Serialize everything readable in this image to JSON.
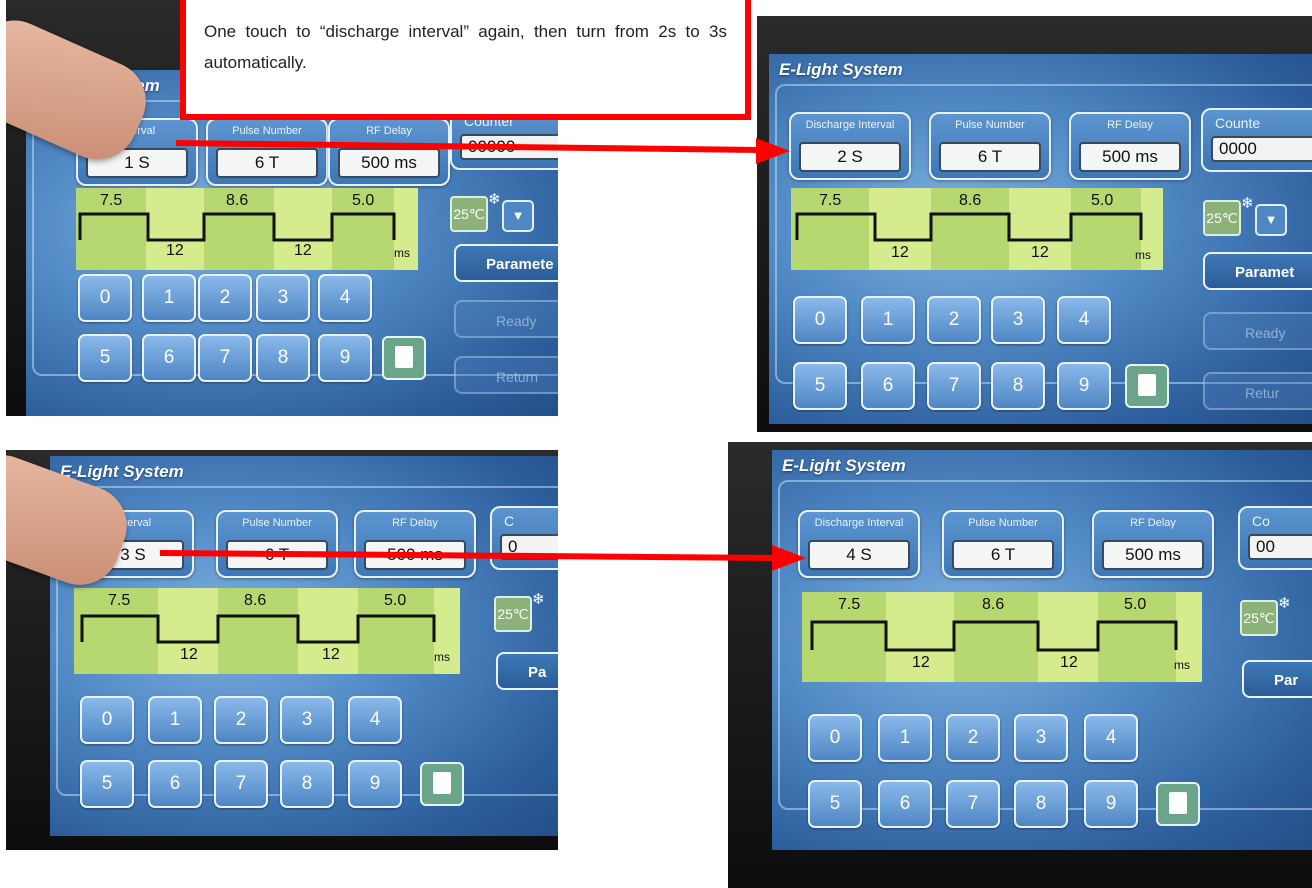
{
  "callout": {
    "text": "One touch to “discharge interval” again, then turn from 2s to 3s automatically."
  },
  "panels": [
    {
      "title": "E-Light System",
      "discharge_label": "Interval",
      "discharge_value": "1 S",
      "pulse_label": "Pulse Number",
      "pulse_value": "6 T",
      "rf_label": "RF Delay",
      "rf_value": "500 ms",
      "counter_label": "Counter",
      "counter_value": "00000",
      "temp": "25℃",
      "parameter_label": "Paramete",
      "ready_label": "Ready",
      "return_label": "Return"
    },
    {
      "title": "E-Light System",
      "discharge_label": "Discharge Interval",
      "discharge_value": "2 S",
      "pulse_label": "Pulse Number",
      "pulse_value": "6 T",
      "rf_label": "RF Delay",
      "rf_value": "500 ms",
      "counter_label": "Counte",
      "counter_value": "0000",
      "temp": "25℃",
      "parameter_label": "Paramet",
      "ready_label": "Ready",
      "return_label": "Retur"
    },
    {
      "title": "E-Light System",
      "discharge_label": "Interval",
      "discharge_value": "3 S",
      "pulse_label": "Pulse Number",
      "pulse_value": "6 T",
      "rf_label": "RF Delay",
      "rf_value": "500 ms",
      "counter_label": "C",
      "counter_value": "0",
      "temp": "25℃",
      "parameter_label": "Pa",
      "ready_label": "",
      "return_label": ""
    },
    {
      "title": "E-Light System",
      "discharge_label": "Discharge Interval",
      "discharge_value": "4 S",
      "pulse_label": "Pulse Number",
      "pulse_value": "6 T",
      "rf_label": "RF Delay",
      "rf_value": "500 ms",
      "counter_label": "Co",
      "counter_value": "00",
      "temp": "25℃",
      "parameter_label": "Par",
      "ready_label": "",
      "return_label": ""
    }
  ],
  "waveform": {
    "pulses": [
      "7.5",
      "8.6",
      "5.0"
    ],
    "gaps": [
      "12",
      "12"
    ],
    "unit": "ms"
  },
  "keypad": {
    "row1": [
      "0",
      "1",
      "2",
      "3",
      "4"
    ],
    "row2": [
      "5",
      "6",
      "7",
      "8",
      "9"
    ],
    "save_icon": "floppy-save-icon"
  },
  "colors": {
    "annotation_red": "#ff0000",
    "screen_blue": "#4f88c4",
    "wave_green": "#b7d770"
  }
}
